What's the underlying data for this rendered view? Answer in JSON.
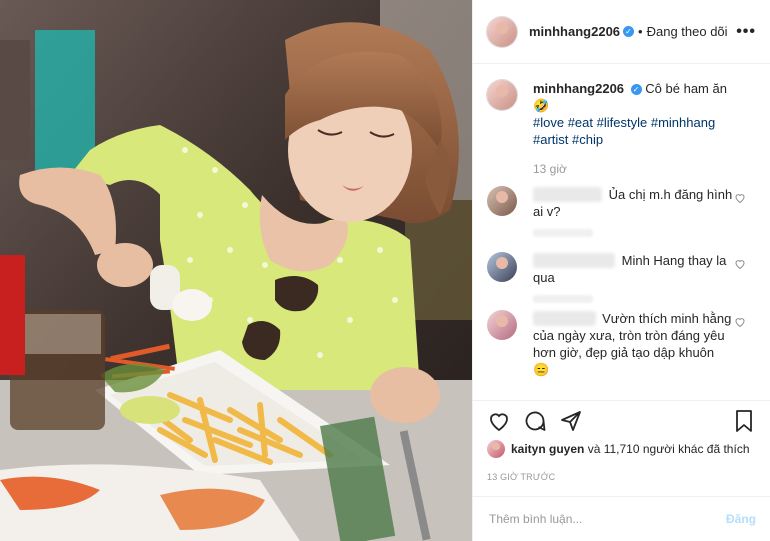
{
  "post": {
    "username": "minhhang2206",
    "follow_status": "Đang theo dõi",
    "more_label": "•••",
    "caption": {
      "username": "minhhang2206",
      "text": "Cô bé ham ăn🤣",
      "tags": [
        "#love",
        "#eat",
        "#lifestyle",
        "#minhhang",
        "#artist",
        "#chip"
      ]
    },
    "caption_time": "13 giờ",
    "comments": [
      {
        "text": "Ủa chị m.h đăng hình ai v?"
      },
      {
        "text": "Minh Hang thay la qua"
      },
      {
        "text": "Vườn thích minh hằng của ngày xưa, tròn tròn đáng yêu hơn giờ, đẹp giả tạo dập khuôn 😑"
      }
    ],
    "likes": {
      "liker": "kaityn guyen",
      "rest": "và 11,710 người khác đã thích"
    },
    "posted_ago": "13 GIỜ TRƯỚC",
    "add_comment_placeholder": "Thêm bình luận...",
    "post_button": "Đăng"
  },
  "icons": {
    "like": "heart-icon",
    "comment": "comment-icon",
    "share": "share-icon",
    "save": "bookmark-icon",
    "verified": "verified-badge"
  },
  "colors": {
    "link": "#003569",
    "verified": "#3897f0",
    "post_button_disabled": "#b2dffc",
    "muted": "#999999"
  }
}
